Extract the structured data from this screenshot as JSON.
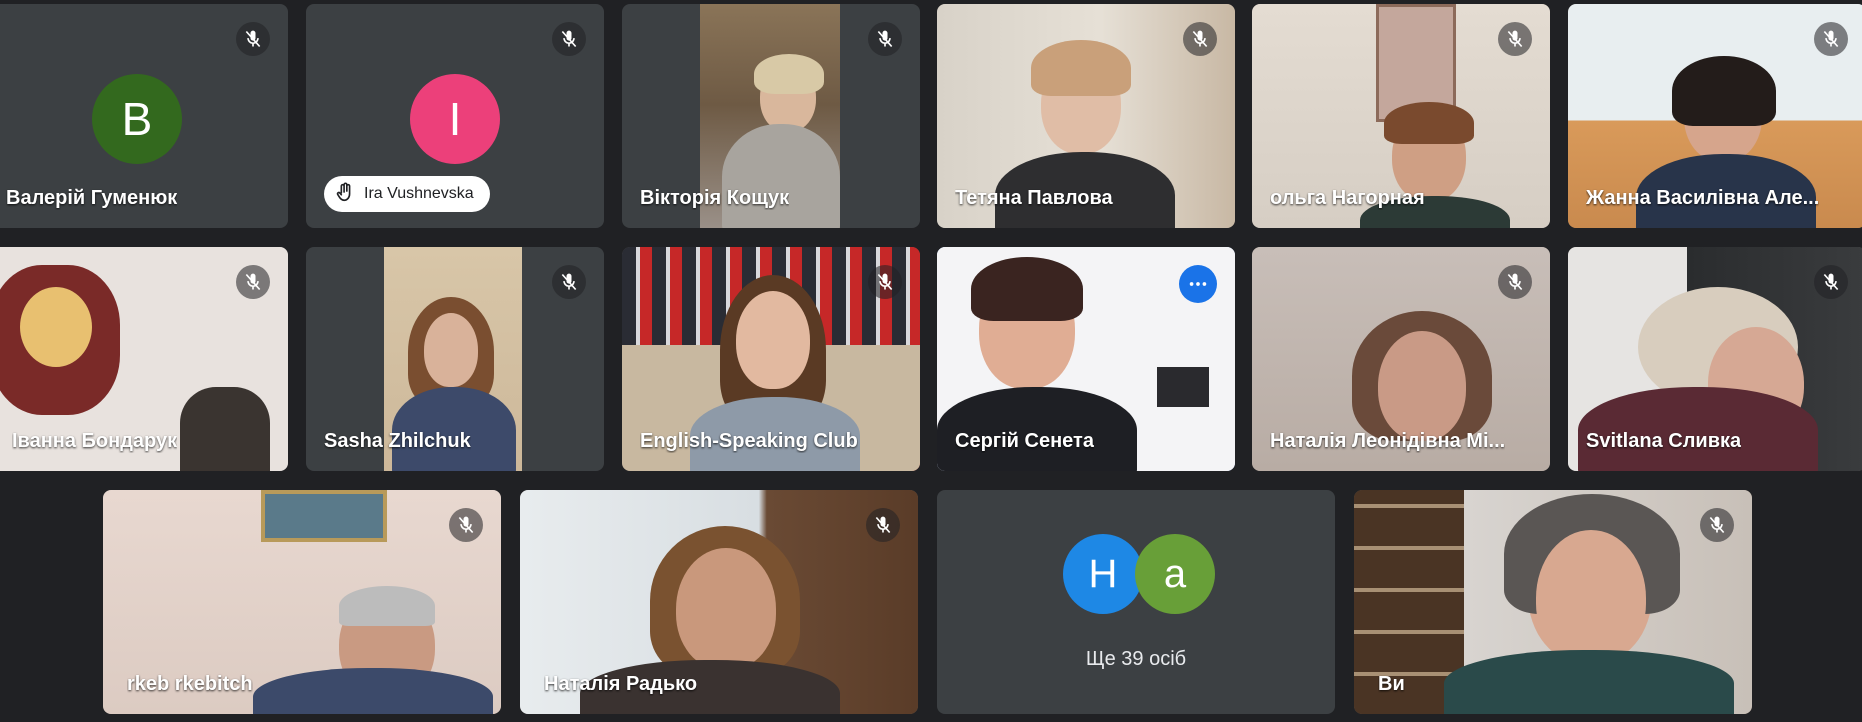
{
  "colors": {
    "background": "#202124",
    "tile": "#3c4043",
    "active_speaker_border": "#8ab4f8",
    "options_button": "#1a73e8"
  },
  "icons": {
    "mute": "mic-off-icon",
    "raised_hand": "hand-icon",
    "options": "more-options-icon"
  },
  "participants": [
    {
      "name": "Валерій Гуменюк",
      "avatar_letter": "В",
      "avatar_color": "#33691e",
      "muted": true
    },
    {
      "name": "Ira Vushnevska",
      "avatar_letter": "I",
      "avatar_color": "#ec407a",
      "muted": true,
      "hand_raised": true
    },
    {
      "name": "Вікторія Кощук",
      "muted": true
    },
    {
      "name": "Тетяна Павлова",
      "muted": true
    },
    {
      "name": "ольга Нагорная",
      "muted": true
    },
    {
      "name": "Жанна Василівна Але...",
      "muted": true
    },
    {
      "name": "Іванна Бондарук",
      "muted": true
    },
    {
      "name": "Sasha Zhilchuk",
      "muted": true
    },
    {
      "name": "English-Speaking Club",
      "muted": true
    },
    {
      "name": "Сергій Сенета",
      "speaking": true
    },
    {
      "name": "Наталія Леонідівна Мі...",
      "muted": true
    },
    {
      "name": "Svitlana Сливка",
      "muted": true
    },
    {
      "name": "rkeb rkebitch",
      "muted": true
    },
    {
      "name": "Наталія Радько",
      "muted": true
    },
    {
      "name": "Ви",
      "muted": true
    }
  ],
  "others": {
    "avatars": [
      {
        "letter": "Н",
        "color": "#1e88e5"
      },
      {
        "letter": "а",
        "color": "#689f38"
      }
    ],
    "label": "Ще 39 осіб"
  }
}
